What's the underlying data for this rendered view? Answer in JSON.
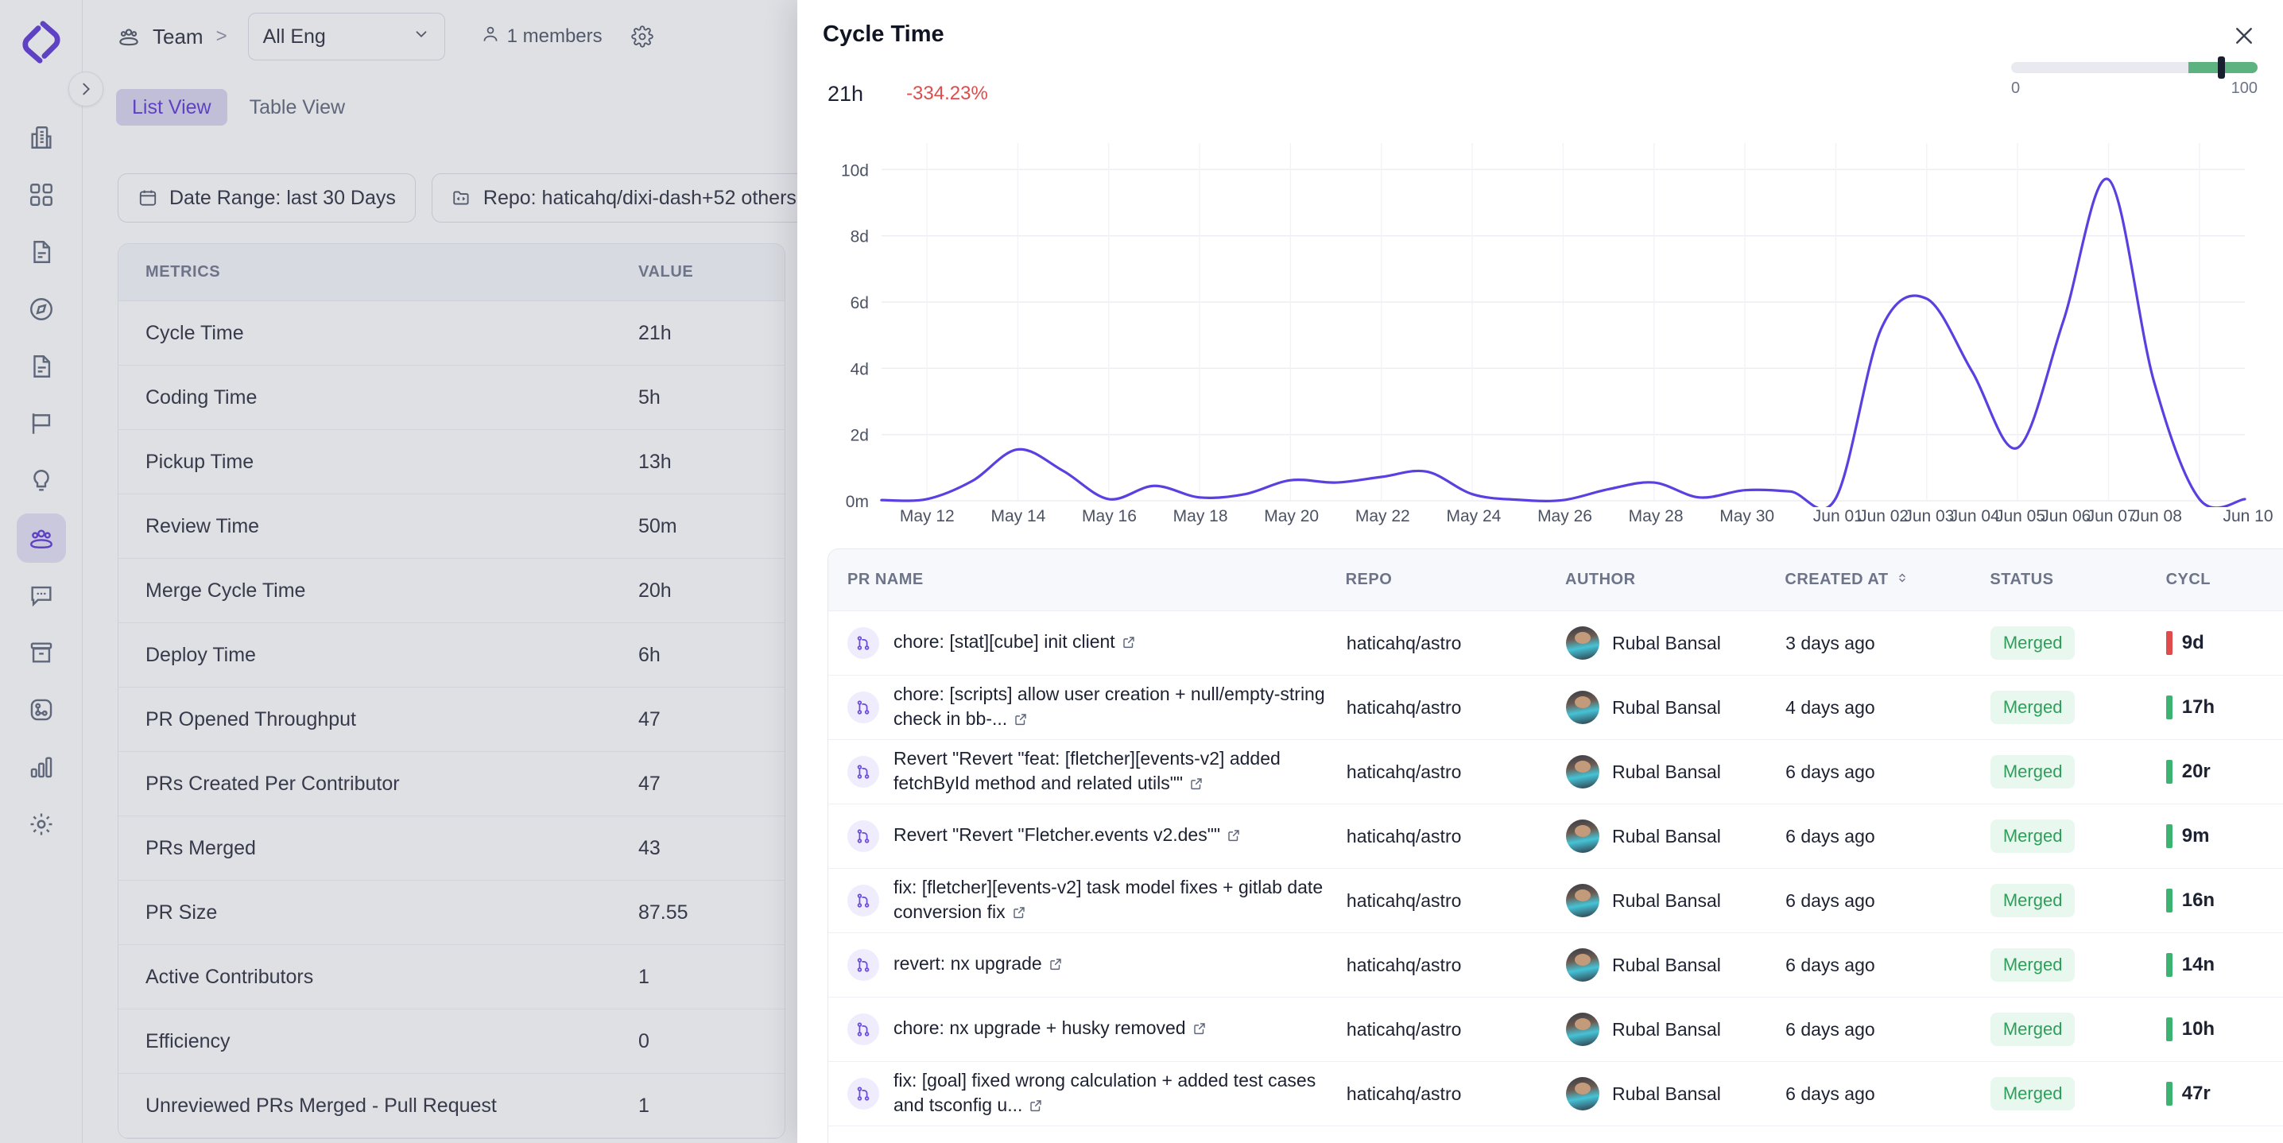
{
  "app": {
    "logo_name": "middleware-logo",
    "rail_items": [
      {
        "name": "building-icon",
        "active": false
      },
      {
        "name": "grid-squares-icon",
        "active": false
      },
      {
        "name": "document-icon",
        "active": false
      },
      {
        "name": "compass-icon",
        "active": false
      },
      {
        "name": "document-lines-icon",
        "active": false
      },
      {
        "name": "flag-icon",
        "active": false
      },
      {
        "name": "lightbulb-icon",
        "active": false
      },
      {
        "name": "team-users-icon",
        "active": true
      },
      {
        "name": "chat-bubble-icon",
        "active": false
      },
      {
        "name": "archive-box-icon",
        "active": false
      },
      {
        "name": "integrations-icon",
        "active": false
      },
      {
        "name": "bar-chart-icon",
        "active": false
      },
      {
        "name": "settings-gear-icon",
        "active": false
      }
    ]
  },
  "topbar": {
    "breadcrumb_label": "Team",
    "breadcrumb_separator": ">",
    "team_selected": "All Eng",
    "members_count_label": "1 members",
    "people_icon": "people-icon",
    "chevron_icon": "chevron-down-icon",
    "gear_icon": "gear-icon"
  },
  "view_tabs": [
    {
      "label": "List View",
      "active": true
    },
    {
      "label": "Table View",
      "active": false
    }
  ],
  "filters": {
    "date_range": "Date Range: last 30 Days",
    "repo": "Repo: haticahq/dixi-dash+52 others",
    "calendar_icon": "calendar-icon",
    "repo_icon": "folder-code-icon",
    "funnel_icon": "filter-funnel-icon"
  },
  "metrics_table": {
    "headers": {
      "name": "METRICS",
      "value": "VALUE"
    },
    "rows": [
      {
        "name": "Cycle Time",
        "value": "21h"
      },
      {
        "name": "Coding Time",
        "value": "5h"
      },
      {
        "name": "Pickup Time",
        "value": "13h"
      },
      {
        "name": "Review Time",
        "value": "50m"
      },
      {
        "name": "Merge Cycle Time",
        "value": "20h"
      },
      {
        "name": "Deploy Time",
        "value": "6h"
      },
      {
        "name": "PR Opened Throughput",
        "value": "47"
      },
      {
        "name": "PRs Created Per Contributor",
        "value": "47"
      },
      {
        "name": "PRs Merged",
        "value": "43"
      },
      {
        "name": "PR Size",
        "value": "87.55"
      },
      {
        "name": "Active Contributors",
        "value": "1"
      },
      {
        "name": "Efficiency",
        "value": "0"
      },
      {
        "name": "Unreviewed PRs Merged - Pull Request",
        "value": "1"
      }
    ]
  },
  "panel": {
    "title": "Cycle Time",
    "close_icon": "close-icon",
    "kpi_value": "21h",
    "kpi_delta": "-334.23%",
    "kpi_delta_color": "#e04b4b",
    "slider": {
      "min_label": "0",
      "max_label": "100",
      "value": 84,
      "fill_start": 72,
      "fill_color": "#5cb37f"
    }
  },
  "chart_data": {
    "type": "line",
    "title": "Cycle Time",
    "xlabel": "",
    "ylabel": "",
    "line_color": "#5b3fe0",
    "grid": true,
    "ytick_labels": [
      "0m",
      "2d",
      "4d",
      "6d",
      "8d",
      "10d"
    ],
    "ytick_values": [
      0,
      2,
      4,
      6,
      8,
      10
    ],
    "ylim": [
      0,
      10.8
    ],
    "xtick_labels": [
      "May 12",
      "May 14",
      "May 16",
      "May 18",
      "May 20",
      "May 22",
      "May 24",
      "May 26",
      "May 28",
      "May 30",
      "Jun 01",
      "Jun 02",
      "Jun 03",
      "Jun 04",
      "Jun 05",
      "Jun 06",
      "Jun 07",
      "Jun 08",
      "Jun 10"
    ],
    "x": [
      "May 11",
      "May 12",
      "May 13",
      "May 14",
      "May 15",
      "May 16",
      "May 17",
      "May 18",
      "May 19",
      "May 20",
      "May 21",
      "May 22",
      "May 23",
      "May 24",
      "May 25",
      "May 26",
      "May 27",
      "May 28",
      "May 29",
      "May 30",
      "May 31",
      "Jun 01",
      "Jun 02",
      "Jun 03",
      "Jun 04",
      "Jun 05",
      "Jun 06",
      "Jun 07",
      "Jun 08",
      "Jun 09",
      "Jun 10"
    ],
    "values": [
      0.02,
      0.05,
      0.6,
      1.55,
      0.9,
      0.05,
      0.45,
      0.1,
      0.2,
      0.62,
      0.55,
      0.72,
      0.88,
      0.2,
      0.03,
      0.02,
      0.35,
      0.55,
      0.1,
      0.32,
      0.28,
      0.08,
      5.2,
      6.1,
      3.9,
      1.6,
      5.4,
      9.7,
      3.6,
      0.05,
      0.05
    ]
  },
  "pr_table": {
    "headers": {
      "name": "PR NAME",
      "repo": "REPO",
      "author": "AUTHOR",
      "created": "CREATED AT",
      "status": "STATUS",
      "cycle": "CYCL",
      "sort_icon": "sort-updown-icon"
    },
    "rows": [
      {
        "title": "chore: [stat][cube] init client",
        "repo": "haticahq/astro",
        "author": "Rubal Bansal",
        "created": "3 days ago",
        "status": "Merged",
        "cycle": "9d",
        "cycle_color": "#e04b4b"
      },
      {
        "title": "chore: [scripts] allow user creation + null/empty-string check in bb-...",
        "repo": "haticahq/astro",
        "author": "Rubal Bansal",
        "created": "4 days ago",
        "status": "Merged",
        "cycle": "17h",
        "cycle_color": "#3cb371"
      },
      {
        "title": "Revert \"Revert \"feat: [fletcher][events-v2] added fetchById method and related utils\"\"",
        "repo": "haticahq/astro",
        "author": "Rubal Bansal",
        "created": "6 days ago",
        "status": "Merged",
        "cycle": "20r",
        "cycle_color": "#3cb371"
      },
      {
        "title": "Revert \"Revert \"Fletcher.events v2.des\"\"",
        "repo": "haticahq/astro",
        "author": "Rubal Bansal",
        "created": "6 days ago",
        "status": "Merged",
        "cycle": "9m",
        "cycle_color": "#3cb371"
      },
      {
        "title": "fix: [fletcher][events-v2] task model fixes + gitlab date conversion fix",
        "repo": "haticahq/astro",
        "author": "Rubal Bansal",
        "created": "6 days ago",
        "status": "Merged",
        "cycle": "16n",
        "cycle_color": "#3cb371"
      },
      {
        "title": "revert: nx upgrade",
        "repo": "haticahq/astro",
        "author": "Rubal Bansal",
        "created": "6 days ago",
        "status": "Merged",
        "cycle": "14n",
        "cycle_color": "#3cb371"
      },
      {
        "title": "chore: nx upgrade + husky removed",
        "repo": "haticahq/astro",
        "author": "Rubal Bansal",
        "created": "6 days ago",
        "status": "Merged",
        "cycle": "10h",
        "cycle_color": "#3cb371"
      },
      {
        "title": "fix: [goal] fixed wrong calculation + added test cases and tsconfig u...",
        "repo": "haticahq/astro",
        "author": "Rubal Bansal",
        "created": "6 days ago",
        "status": "Merged",
        "cycle": "47r",
        "cycle_color": "#3cb371"
      }
    ]
  }
}
